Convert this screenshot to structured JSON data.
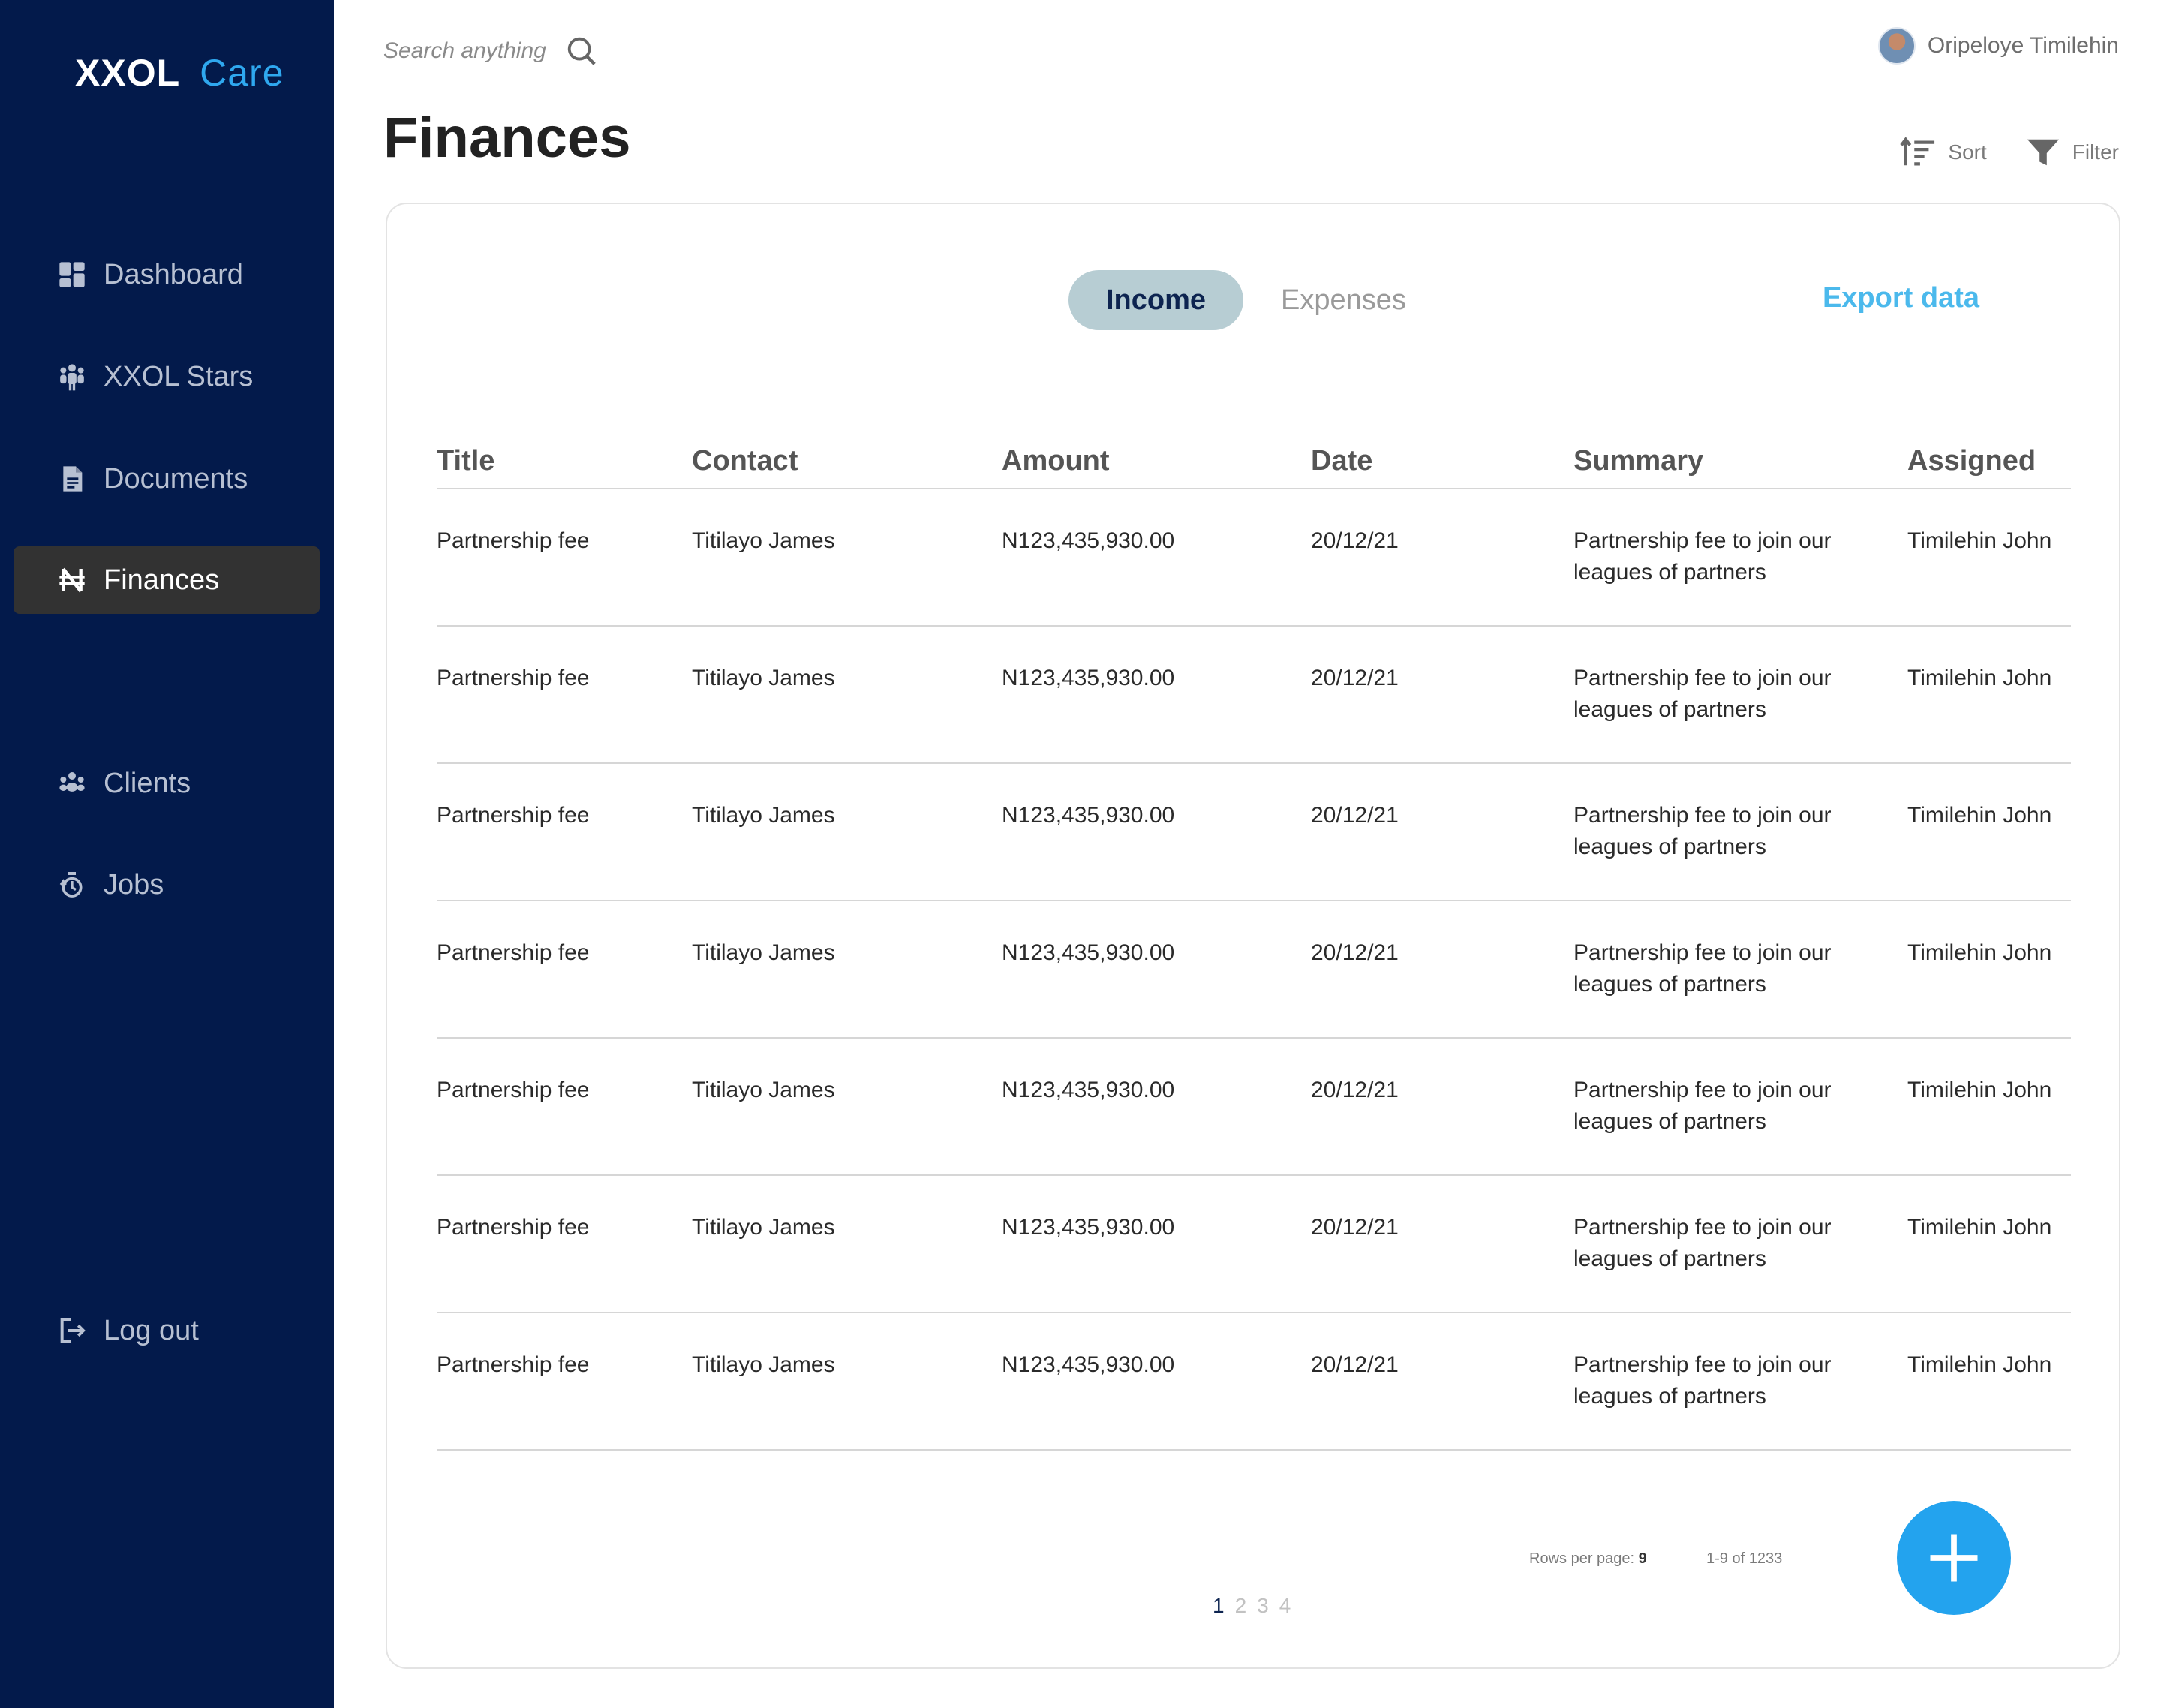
{
  "app": {
    "brand": "XXOL",
    "brand_suffix": "Care"
  },
  "sidebar": {
    "items": [
      {
        "label": "Dashboard",
        "icon": "dashboard-icon",
        "active": false
      },
      {
        "label": "XXOL Stars",
        "icon": "people-group-icon",
        "active": false
      },
      {
        "label": "Documents",
        "icon": "document-icon",
        "active": false
      },
      {
        "label": "Finances",
        "icon": "naira-icon",
        "active": true
      },
      {
        "label": "Clients",
        "icon": "clients-icon",
        "active": false
      },
      {
        "label": "Jobs",
        "icon": "jobs-icon",
        "active": false
      }
    ],
    "logout_label": "Log out"
  },
  "header": {
    "search_placeholder": "Search anything",
    "user_name": "Oripeloye Timilehin",
    "page_title": "Finances",
    "sort_label": "Sort",
    "filter_label": "Filter"
  },
  "card": {
    "tabs": [
      {
        "label": "Income",
        "active": true
      },
      {
        "label": "Expenses",
        "active": false
      }
    ],
    "export_label": "Export data",
    "columns": [
      "Title",
      "Contact",
      "Amount",
      "Date",
      "Summary",
      "Assigned"
    ],
    "rows": [
      [
        "Partnership fee",
        "Titilayo James",
        "N123,435,930.00",
        "20/12/21",
        "Partnership fee to join our leagues of partners",
        "Timilehin John"
      ],
      [
        "Partnership fee",
        "Titilayo James",
        "N123,435,930.00",
        "20/12/21",
        "Partnership fee to join our leagues of partners",
        "Timilehin John"
      ],
      [
        "Partnership fee",
        "Titilayo James",
        "N123,435,930.00",
        "20/12/21",
        "Partnership fee to join our leagues of partners",
        "Timilehin John"
      ],
      [
        "Partnership fee",
        "Titilayo James",
        "N123,435,930.00",
        "20/12/21",
        "Partnership fee to join our leagues of partners",
        "Timilehin John"
      ],
      [
        "Partnership fee",
        "Titilayo James",
        "N123,435,930.00",
        "20/12/21",
        "Partnership fee to join our leagues of partners",
        "Timilehin John"
      ],
      [
        "Partnership fee",
        "Titilayo James",
        "N123,435,930.00",
        "20/12/21",
        "Partnership fee to join our leagues of partners",
        "Timilehin John"
      ],
      [
        "Partnership fee",
        "Titilayo James",
        "N123,435,930.00",
        "20/12/21",
        "Partnership fee to join our leagues of partners",
        "Timilehin John"
      ]
    ],
    "pagination": {
      "rows_per_page_label": "Rows per page:",
      "rows_per_page_value": "9",
      "range_text": "1-9 of 1233",
      "pages": [
        "1",
        "2",
        "3",
        "4"
      ],
      "current_page": "1"
    }
  },
  "colors": {
    "sidebar_bg": "#031a4b",
    "active_nav_bg": "#323232",
    "accent": "#23a3ee",
    "active_tab_bg": "#b7cdd3"
  }
}
